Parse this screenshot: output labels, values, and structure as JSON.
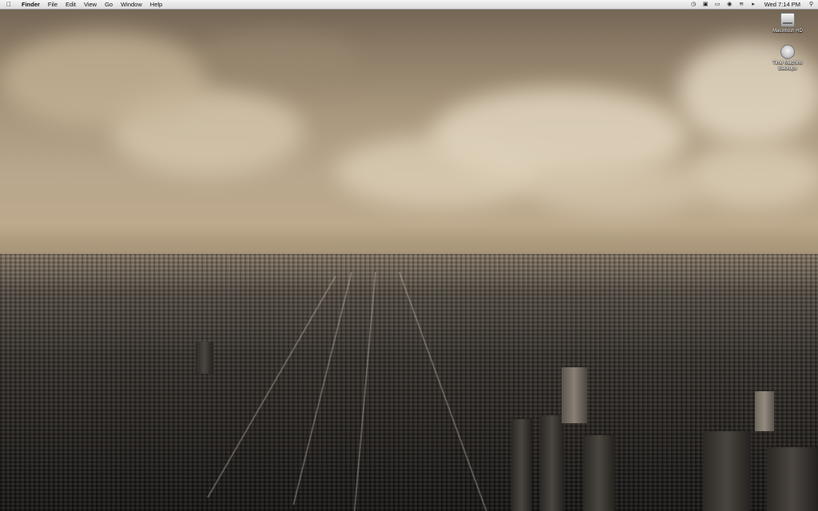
{
  "menubar": {
    "app_name": "Finder",
    "menus": [
      "File",
      "Edit",
      "View",
      "Go",
      "Window",
      "Help"
    ],
    "clock": "Wed 7:14 PM",
    "status_icons": [
      "time-machine-icon",
      "display-icon",
      "battery-icon",
      "lock-icon",
      "wifi-icon",
      "volume-icon"
    ]
  },
  "desktop": {
    "icons": [
      {
        "label": "Macintosh HD",
        "icon": "hard-drive-icon"
      },
      {
        "label": "Time Machine Backups",
        "icon": "time-machine-drive-icon"
      }
    ]
  },
  "colors": {
    "sky": "#b9a78d",
    "city": "#2a2622",
    "menubar": "#e8e8e8"
  }
}
